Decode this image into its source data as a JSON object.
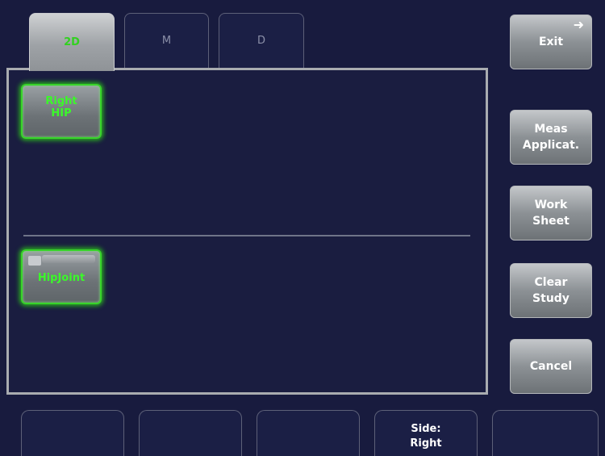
{
  "tabs": [
    {
      "label": "2D",
      "active": true
    },
    {
      "label": "M",
      "active": false
    },
    {
      "label": "D",
      "active": false
    }
  ],
  "panel": {
    "app_button_label": "Right\nHIP",
    "measurement_button_label": "HipJoint"
  },
  "side_buttons": {
    "exit": "Exit",
    "exit_icon": "arrow-right-icon",
    "meas_applicat": "Meas\nApplicat.",
    "work_sheet": "Work\nSheet",
    "clear_study": "Clear\nStudy",
    "cancel": "Cancel"
  },
  "bottom_keys": {
    "key1": "",
    "key2": "",
    "key3": "",
    "key4": "Side:\nRight",
    "key5": ""
  },
  "colors": {
    "background": "#181b3e",
    "active_green": "#3bf82a",
    "panel_border": "#a9acb0"
  }
}
